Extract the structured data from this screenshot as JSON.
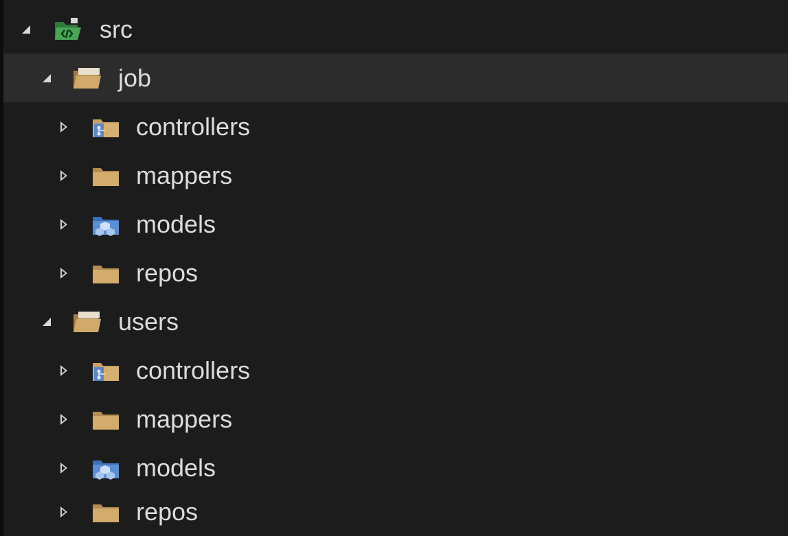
{
  "tree": {
    "rows": [
      {
        "label": "src",
        "icon": "code-folder-icon",
        "expanded": true,
        "level": 0,
        "selected": false
      },
      {
        "label": "job",
        "icon": "folder-open-icon",
        "expanded": true,
        "level": 1,
        "selected": true
      },
      {
        "label": "controllers",
        "icon": "controllers-folder-icon",
        "expanded": false,
        "level": 2,
        "selected": false
      },
      {
        "label": "mappers",
        "icon": "folder-icon",
        "expanded": false,
        "level": 2,
        "selected": false
      },
      {
        "label": "models",
        "icon": "models-folder-icon",
        "expanded": false,
        "level": 2,
        "selected": false
      },
      {
        "label": "repos",
        "icon": "folder-icon",
        "expanded": false,
        "level": 2,
        "selected": false
      },
      {
        "label": "users",
        "icon": "folder-open-icon",
        "expanded": true,
        "level": 1,
        "selected": false
      },
      {
        "label": "controllers",
        "icon": "controllers-folder-icon",
        "expanded": false,
        "level": 2,
        "selected": false
      },
      {
        "label": "mappers",
        "icon": "folder-icon",
        "expanded": false,
        "level": 2,
        "selected": false
      },
      {
        "label": "models",
        "icon": "models-folder-icon",
        "expanded": false,
        "level": 2,
        "selected": false
      },
      {
        "label": "repos",
        "icon": "folder-icon",
        "expanded": false,
        "level": 2,
        "selected": false
      }
    ]
  },
  "colors": {
    "background": "#1c1c1c",
    "selected_row": "#2c2c2c",
    "text": "#dcdcdc",
    "folder_tan": "#c9a165",
    "code_green": "#3e9a4a",
    "models_blue": "#4d7fc8"
  }
}
